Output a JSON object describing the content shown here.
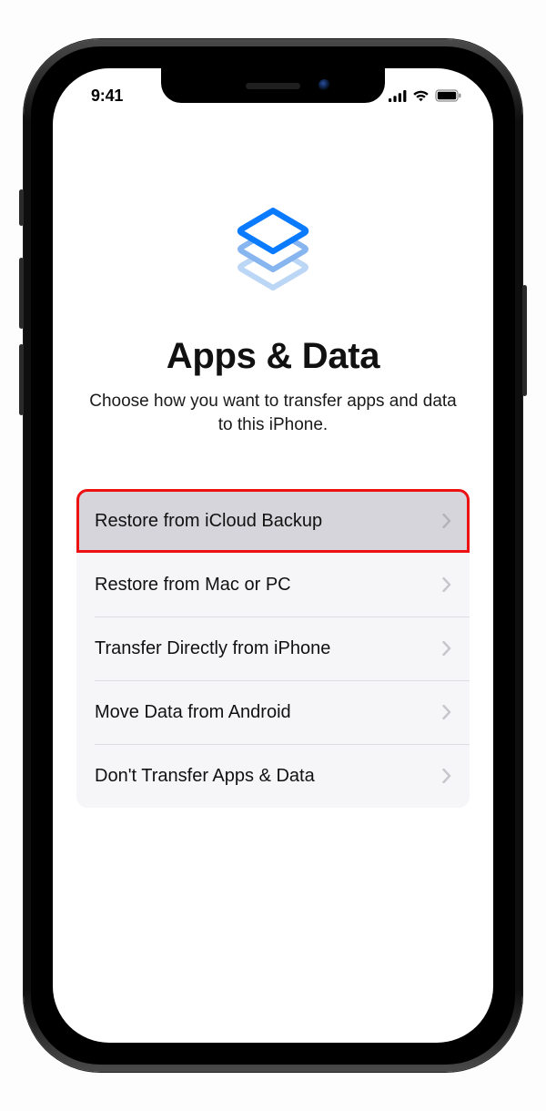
{
  "status": {
    "time": "9:41"
  },
  "page": {
    "title": "Apps & Data",
    "subtitle": "Choose how you want to transfer apps and data to this iPhone."
  },
  "options": [
    {
      "label": "Restore from iCloud Backup",
      "highlight": true
    },
    {
      "label": "Restore from Mac or PC",
      "highlight": false
    },
    {
      "label": "Transfer Directly from iPhone",
      "highlight": false
    },
    {
      "label": "Move Data from Android",
      "highlight": false
    },
    {
      "label": "Don't Transfer Apps & Data",
      "highlight": false
    }
  ]
}
